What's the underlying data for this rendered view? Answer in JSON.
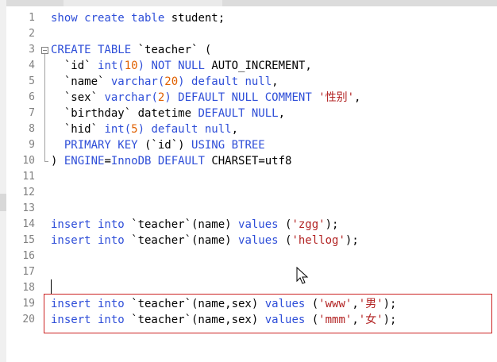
{
  "editor": {
    "lines": [
      {
        "n": "1",
        "tokens": [
          {
            "t": "show create table",
            "c": "kw"
          },
          {
            "t": " student;",
            "c": "plain"
          }
        ]
      },
      {
        "n": "2",
        "tokens": []
      },
      {
        "n": "3",
        "fold": "box",
        "tokens": [
          {
            "t": "CREATE TABLE",
            "c": "kw"
          },
          {
            "t": " `teacher` (",
            "c": "plain"
          }
        ]
      },
      {
        "n": "4",
        "fold": "line",
        "tokens": [
          {
            "t": "  `id` ",
            "c": "plain"
          },
          {
            "t": "int(",
            "c": "kw"
          },
          {
            "t": "10",
            "c": "num"
          },
          {
            "t": ") ",
            "c": "kw"
          },
          {
            "t": "NOT NULL",
            "c": "kw"
          },
          {
            "t": " AUTO_INCREMENT,",
            "c": "plain"
          }
        ]
      },
      {
        "n": "5",
        "fold": "line",
        "tokens": [
          {
            "t": "  `name` ",
            "c": "plain"
          },
          {
            "t": "varchar(",
            "c": "kw"
          },
          {
            "t": "20",
            "c": "num"
          },
          {
            "t": ") default null",
            "c": "kw"
          },
          {
            "t": ",",
            "c": "plain"
          }
        ]
      },
      {
        "n": "6",
        "fold": "line",
        "tokens": [
          {
            "t": "  `sex` ",
            "c": "plain"
          },
          {
            "t": "varchar(",
            "c": "kw"
          },
          {
            "t": "2",
            "c": "num"
          },
          {
            "t": ") DEFAULT NULL COMMENT ",
            "c": "kw"
          },
          {
            "t": "'性别'",
            "c": "str"
          },
          {
            "t": ",",
            "c": "plain"
          }
        ]
      },
      {
        "n": "7",
        "fold": "line",
        "tokens": [
          {
            "t": "  `birthday` datetime ",
            "c": "plain"
          },
          {
            "t": "DEFAULT NULL",
            "c": "kw"
          },
          {
            "t": ",",
            "c": "plain"
          }
        ]
      },
      {
        "n": "8",
        "fold": "line",
        "tokens": [
          {
            "t": "  `hid` ",
            "c": "plain"
          },
          {
            "t": "int(",
            "c": "kw"
          },
          {
            "t": "5",
            "c": "num"
          },
          {
            "t": ") default null",
            "c": "kw"
          },
          {
            "t": ",",
            "c": "plain"
          }
        ]
      },
      {
        "n": "9",
        "fold": "line",
        "tokens": [
          {
            "t": "  PRIMARY KEY",
            "c": "kw"
          },
          {
            "t": " (`id`) ",
            "c": "plain"
          },
          {
            "t": "USING BTREE",
            "c": "kw"
          }
        ]
      },
      {
        "n": "10",
        "fold": "end",
        "tokens": [
          {
            "t": ") ",
            "c": "plain"
          },
          {
            "t": "ENGINE",
            "c": "kw"
          },
          {
            "t": "=",
            "c": "plain"
          },
          {
            "t": "InnoDB DEFAULT",
            "c": "kw"
          },
          {
            "t": " CHARSET=utf8",
            "c": "plain"
          }
        ]
      },
      {
        "n": "11",
        "tokens": []
      },
      {
        "n": "12",
        "tokens": []
      },
      {
        "n": "13",
        "tokens": []
      },
      {
        "n": "14",
        "tokens": [
          {
            "t": "insert into",
            "c": "kw"
          },
          {
            "t": " `teacher`(name) ",
            "c": "plain"
          },
          {
            "t": "values",
            "c": "kw"
          },
          {
            "t": " (",
            "c": "plain"
          },
          {
            "t": "'zgg'",
            "c": "str"
          },
          {
            "t": ");",
            "c": "plain"
          }
        ]
      },
      {
        "n": "15",
        "tokens": [
          {
            "t": "insert into",
            "c": "kw"
          },
          {
            "t": " `teacher`(name) ",
            "c": "plain"
          },
          {
            "t": "values",
            "c": "kw"
          },
          {
            "t": " (",
            "c": "plain"
          },
          {
            "t": "'hellog'",
            "c": "str"
          },
          {
            "t": ");",
            "c": "plain"
          }
        ]
      },
      {
        "n": "16",
        "tokens": []
      },
      {
        "n": "17",
        "tokens": []
      },
      {
        "n": "18",
        "tokens": []
      },
      {
        "n": "19",
        "tokens": [
          {
            "t": "insert into",
            "c": "kw"
          },
          {
            "t": " `teacher`(name,sex) ",
            "c": "plain"
          },
          {
            "t": "values",
            "c": "kw"
          },
          {
            "t": " (",
            "c": "plain"
          },
          {
            "t": "'www'",
            "c": "str"
          },
          {
            "t": ",",
            "c": "plain"
          },
          {
            "t": "'男'",
            "c": "str"
          },
          {
            "t": ");",
            "c": "plain"
          }
        ]
      },
      {
        "n": "20",
        "tokens": [
          {
            "t": "insert into",
            "c": "kw"
          },
          {
            "t": " `teacher`(name,sex) ",
            "c": "plain"
          },
          {
            "t": "values",
            "c": "kw"
          },
          {
            "t": " (",
            "c": "plain"
          },
          {
            "t": "'mmm'",
            "c": "str"
          },
          {
            "t": ",",
            "c": "plain"
          },
          {
            "t": "'女'",
            "c": "str"
          },
          {
            "t": ");",
            "c": "plain"
          }
        ]
      }
    ]
  },
  "colors": {
    "keyword": "#2e4ed8",
    "string": "#b22222",
    "number": "#e06000",
    "highlight_border": "#cc2222"
  },
  "icons": {
    "mouse_cursor": "arrow-cursor-icon"
  }
}
